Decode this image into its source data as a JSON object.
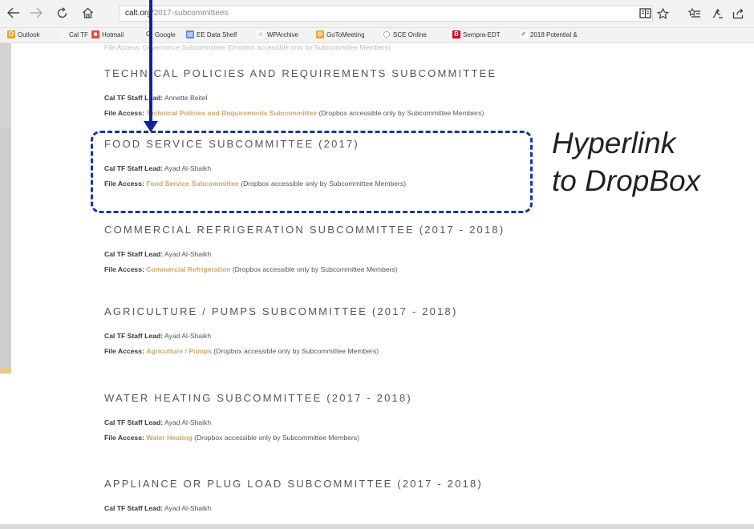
{
  "browser": {
    "url_domain": "calt",
    "url_domain_rest": "org",
    "url_path": "/2017-subcommittees"
  },
  "favorites": [
    {
      "label": "Outlook",
      "icon": "outlook-icon",
      "color": "#e8a321",
      "glyph": "O"
    },
    {
      "label": "Cal TF",
      "icon": "page-icon",
      "color": "#f6f6f6",
      "glyph": ""
    },
    {
      "label": "Hotmail",
      "icon": "windows-icon",
      "color": "#e74c3c",
      "glyph": "■"
    },
    {
      "label": "Google",
      "icon": "google-icon",
      "color": "#ffffff",
      "glyph": "G"
    },
    {
      "label": "EE Data Shelf",
      "icon": "data-icon",
      "color": "#5b8fd6",
      "glyph": "▤"
    },
    {
      "label": "WPArchive",
      "icon": "star-icon",
      "color": "#ffffff",
      "glyph": "☆"
    },
    {
      "label": "GoToMeeting",
      "icon": "flower-icon",
      "color": "#f5a623",
      "glyph": "✿"
    },
    {
      "label": "SCE Online",
      "icon": "circle-icon",
      "color": "#ffffff",
      "glyph": "◯"
    },
    {
      "label": "Sempra-EDT",
      "icon": "b-icon",
      "color": "#d0021b",
      "glyph": "B"
    },
    {
      "label": "2018 Potential &",
      "icon": "folder-icon",
      "color": "#ffffff",
      "glyph": "✐"
    }
  ],
  "cut_line": "File Access: Governance Subcommittee (Dropbox accessible only by Subcommittee Members)",
  "sections": [
    {
      "title": "TECHNICAL POLICIES AND REQUIREMENTS SUBCOMMITTEE",
      "lead_label": "Cal TF Staff Lead:",
      "lead_name": "Annette Beitel",
      "access_label": "File Access:",
      "access_link": "Technical Policies and Requirements Subcommittee",
      "access_note": "(Dropbox accessible only by Subcommittee Members)"
    },
    {
      "title": "FOOD SERVICE SUBCOMMITTEE (2017)",
      "lead_label": "Cal TF Staff Lead:",
      "lead_name": "Ayad Al-Shaikh",
      "access_label": "File Access:",
      "access_link": "Food Service Subcommittee",
      "access_note": "(Dropbox accessible only by Subcommittee Members)"
    },
    {
      "title": "COMMERCIAL REFRIGERATION SUBCOMMITTEE (2017 - 2018)",
      "lead_label": "Cal TF Staff Lead:",
      "lead_name": "Ayad Al-Shaikh",
      "access_label": "File Access:",
      "access_link": "Commercial Refrigeration",
      "access_note": "(Dropbox accessible only by Subcommittee Members)"
    },
    {
      "title": "AGRICULTURE / PUMPS SUBCOMMITTEE (2017 - 2018)",
      "lead_label": "Cal TF Staff Lead:",
      "lead_name": "Ayad Al-Shaikh",
      "access_label": "File Access:",
      "access_link": "Agriculture / Pumps",
      "access_note": "(Dropbox accessible only by Subcommittee Members)"
    },
    {
      "title": "WATER HEATING SUBCOMMITTEE (2017 - 2018)",
      "lead_label": "Cal TF Staff Lead:",
      "lead_name": "Ayad Al-Shaikh",
      "access_label": "File Access:",
      "access_link": "Water Heating",
      "access_note": "(Dropbox accessible only by Subcommittee Members)"
    },
    {
      "title": "APPLIANCE OR PLUG LOAD SUBCOMMITTEE (2017 - 2018)",
      "lead_label": "Cal TF Staff Lead:",
      "lead_name": "Ayad Al-Shaikh"
    }
  ],
  "annotation": {
    "line1": "Hyperlink",
    "line2": "to DropBox",
    "color": "#1a32a8"
  }
}
